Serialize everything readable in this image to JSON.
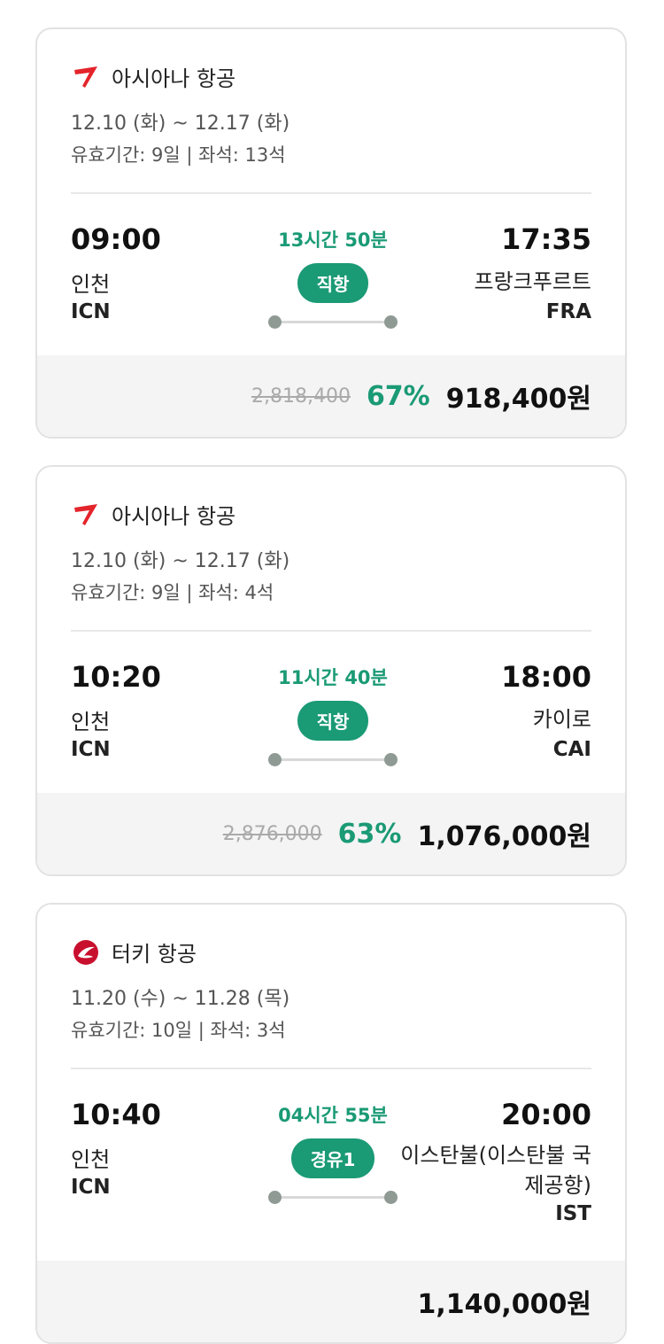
{
  "flights": [
    {
      "airline": "아시아나 항공",
      "airline_icon": "asiana-logo-icon",
      "dates": "12.10 (화) ~ 12.17 (화)",
      "validity": "유효기간: 9일 | 좌석: 13석",
      "departure": {
        "time": "09:00",
        "city": "인천",
        "code": "ICN"
      },
      "arrival": {
        "time": "17:35",
        "city": "프랑크푸르트",
        "code": "FRA"
      },
      "duration": "13시간 50분",
      "stop_badge": "직항",
      "original_price": "2,818,400",
      "discount": "67%",
      "price": "918,400원"
    },
    {
      "airline": "아시아나 항공",
      "airline_icon": "asiana-logo-icon",
      "dates": "12.10 (화) ~ 12.17 (화)",
      "validity": "유효기간: 9일 | 좌석: 4석",
      "departure": {
        "time": "10:20",
        "city": "인천",
        "code": "ICN"
      },
      "arrival": {
        "time": "18:00",
        "city": "카이로",
        "code": "CAI"
      },
      "duration": "11시간 40분",
      "stop_badge": "직항",
      "original_price": "2,876,000",
      "discount": "63%",
      "price": "1,076,000원"
    },
    {
      "airline": "터키 항공",
      "airline_icon": "turkish-airlines-logo-icon",
      "dates": "11.20 (수) ~ 11.28 (목)",
      "validity": "유효기간: 10일 | 좌석: 3석",
      "departure": {
        "time": "10:40",
        "city": "인천",
        "code": "ICN"
      },
      "arrival": {
        "time": "20:00",
        "city": "이스탄불(이스탄불 국제공항)",
        "code": "IST"
      },
      "duration": "04시간 55분",
      "stop_badge": "경유1",
      "original_price": "",
      "discount": "",
      "price": "1,140,000원"
    }
  ],
  "colors": {
    "accent": "#1a9a75",
    "asiana_red": "#e4242b",
    "turkish_red": "#c8102e"
  }
}
